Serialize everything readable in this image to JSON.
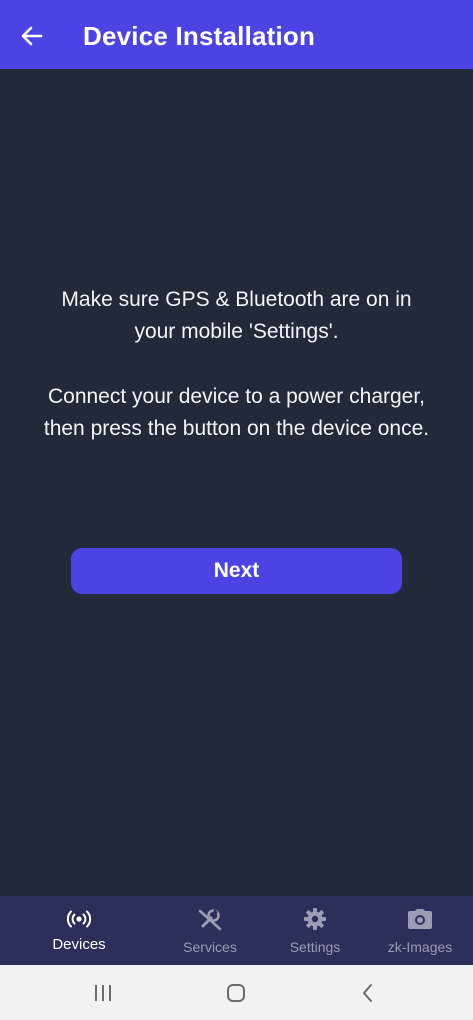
{
  "appbar": {
    "title": "Device Installation",
    "back_icon": "arrow-left-icon"
  },
  "content": {
    "message_line1": "Make sure GPS & Bluetooth are on in your mobile 'Settings'.",
    "message_line2": "Connect your device to a power charger, then press the button on the device once.",
    "next_label": "Next"
  },
  "bottom_nav": {
    "items": [
      {
        "label": "Devices",
        "icon": "broadcast-icon",
        "active": true
      },
      {
        "label": "Services",
        "icon": "services-wrench-icon",
        "active": false
      },
      {
        "label": "Settings",
        "icon": "gear-icon",
        "active": false
      },
      {
        "label": "zk-Images",
        "icon": "camera-icon",
        "active": false
      }
    ]
  },
  "system_nav": {
    "recents_icon": "recents-icon",
    "home_icon": "home-icon",
    "back_icon": "system-back-icon"
  },
  "colors": {
    "accent": "#4b44e3",
    "background": "#222a3a",
    "bottom_nav_bg": "#2c2f5a",
    "system_bar_bg": "#f2f2f2"
  }
}
